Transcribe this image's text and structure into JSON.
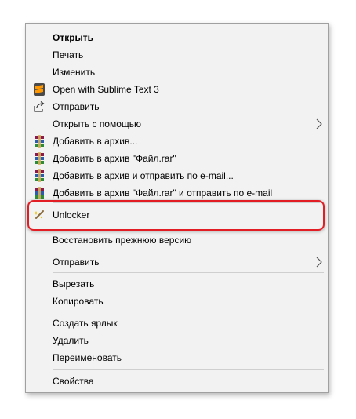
{
  "menu": {
    "items": [
      {
        "label": "Открыть",
        "bold": true
      },
      {
        "label": "Печать"
      },
      {
        "label": "Изменить"
      },
      {
        "label": "Open with Sublime Text 3",
        "icon": "sublime-text-icon"
      },
      {
        "label": "Отправить",
        "icon": "share-icon"
      },
      {
        "label": "Открыть с помощью",
        "submenu": true
      },
      {
        "label": "Добавить в архив...",
        "icon": "winrar-icon"
      },
      {
        "label": "Добавить в архив \"Файл.rar\"",
        "icon": "winrar-icon"
      },
      {
        "label": "Добавить в архив и отправить по e-mail...",
        "icon": "winrar-icon"
      },
      {
        "label": "Добавить в архив \"Файл.rar\" и отправить по e-mail",
        "icon": "winrar-icon"
      },
      {
        "label": "Unlocker",
        "icon": "unlocker-wand-icon",
        "highlighted": true
      },
      {
        "label": "Восстановить прежнюю версию"
      },
      {
        "label": "Отправить",
        "submenu": true
      },
      {
        "label": "Вырезать"
      },
      {
        "label": "Копировать"
      },
      {
        "label": "Создать ярлык"
      },
      {
        "label": "Удалить"
      },
      {
        "label": "Переименовать"
      },
      {
        "label": "Свойства"
      }
    ]
  },
  "colors": {
    "menu_background": "#f2f2f2",
    "menu_border": "#a0a0a0",
    "separator": "#cfcfcf",
    "highlight_outline": "#e21e24"
  }
}
